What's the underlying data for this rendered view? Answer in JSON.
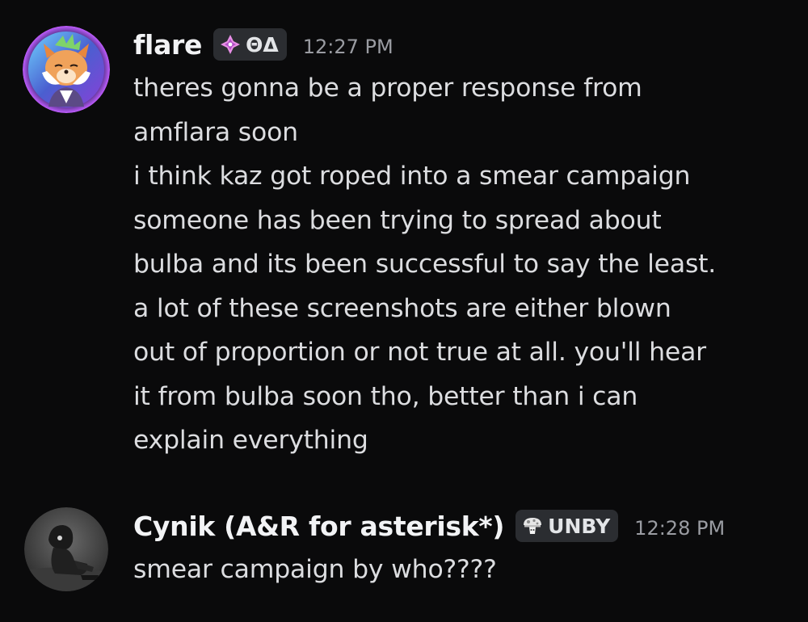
{
  "messages": [
    {
      "username": "flare",
      "tag": "ΘΔ",
      "tag_icon": "sparkle-diamond-icon",
      "timestamp": "12:27 PM",
      "avatar": "fox-avatar",
      "lines": [
        "theres gonna be a proper response from",
        "amflara soon",
        "i think kaz got roped into a smear campaign",
        "someone has been trying to spread about",
        "bulba and its been successful to say the least.",
        "a lot of these screenshots are either blown",
        "out of proportion or not true at all. you'll hear",
        "it from bulba soon tho, better than i can",
        "explain everything"
      ]
    },
    {
      "username": "Cynik (A&R for asterisk*)",
      "tag": "UNBY",
      "tag_icon": "mushroom-icon",
      "timestamp": "12:28 PM",
      "avatar": "hooded-figure-avatar",
      "lines": [
        "smear campaign by who????"
      ]
    }
  ],
  "colors": {
    "background": "#0a0a0b",
    "username": "#f2f3f5",
    "message_text": "#dcdde0",
    "timestamp": "#9a9ca2",
    "tag_background": "#2b2d31"
  }
}
